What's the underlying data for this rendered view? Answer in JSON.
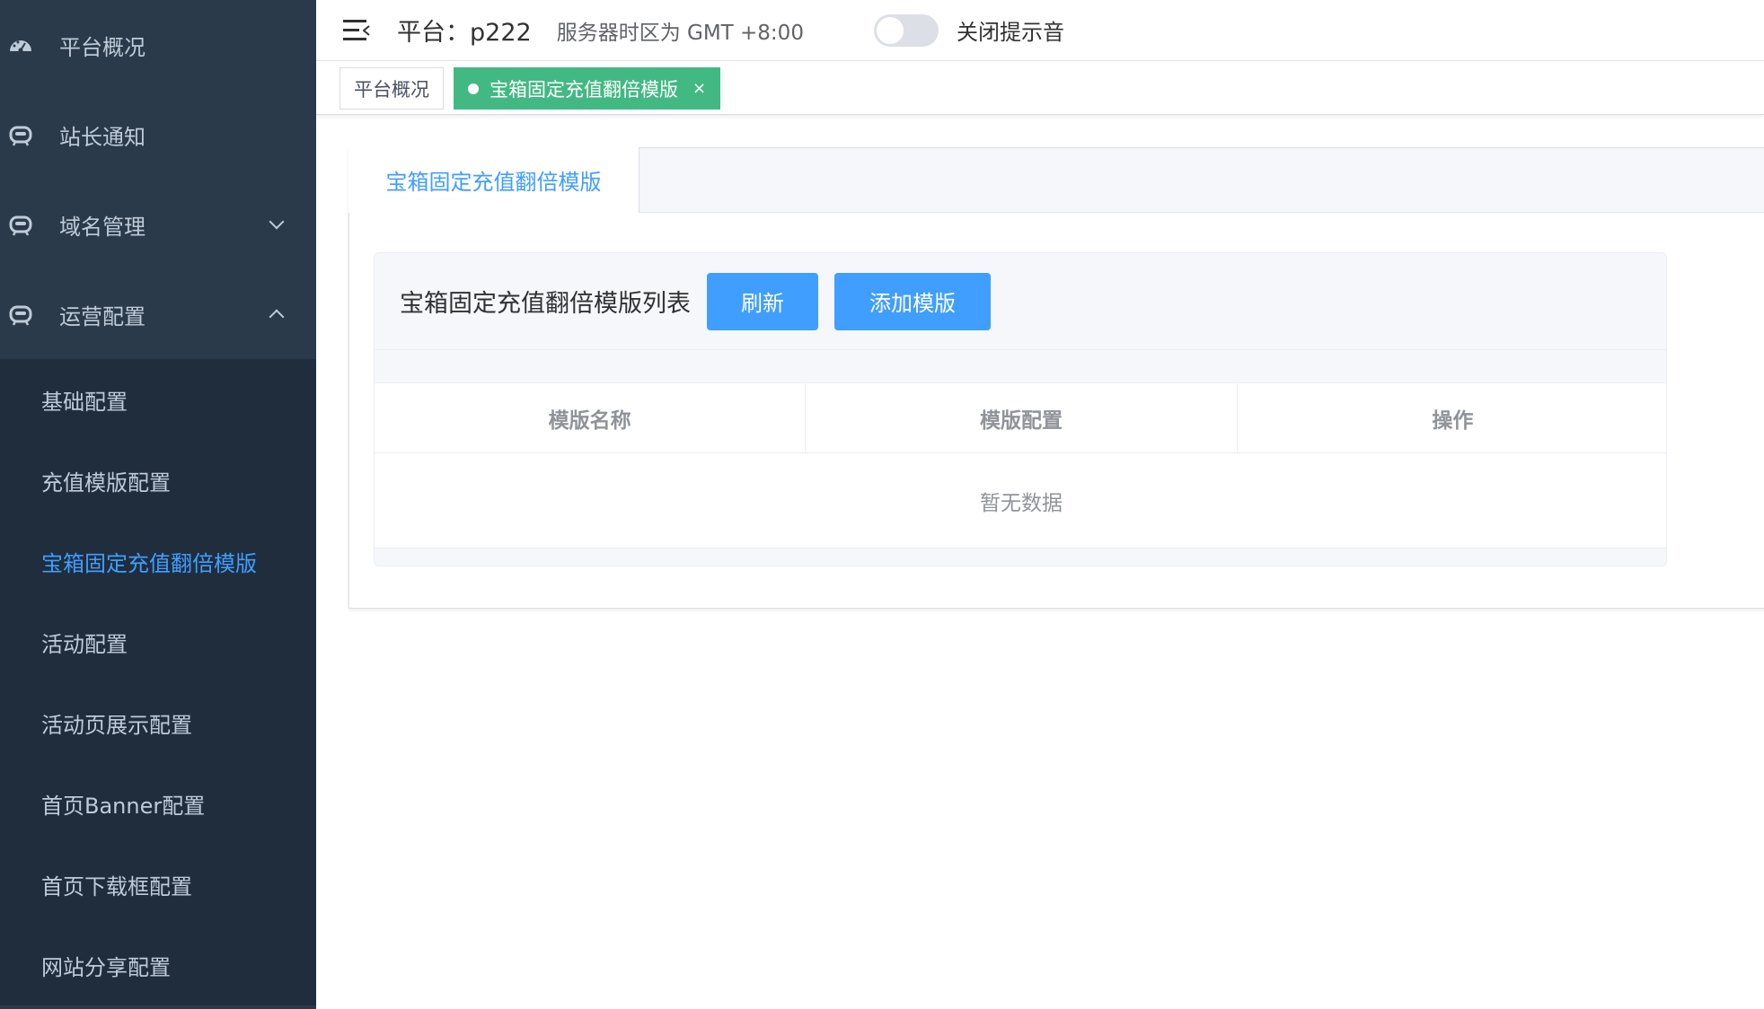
{
  "sidebar": {
    "menus": [
      {
        "label": "平台概况",
        "icon": "dashboard-icon"
      },
      {
        "label": "站长通知",
        "icon": "robot-icon"
      },
      {
        "label": "域名管理",
        "icon": "robot-icon",
        "arrow": "chevron-down-icon"
      },
      {
        "label": "运营配置",
        "icon": "robot-icon",
        "arrow": "chevron-up-icon"
      }
    ],
    "submenu": [
      {
        "label": "基础配置"
      },
      {
        "label": "充值模版配置"
      },
      {
        "label": "宝箱固定充值翻倍模版",
        "active": true
      },
      {
        "label": "活动配置"
      },
      {
        "label": "活动页展示配置"
      },
      {
        "label": "首页Banner配置"
      },
      {
        "label": "首页下载框配置"
      },
      {
        "label": "网站分享配置"
      }
    ]
  },
  "header": {
    "platform": "平台：p222",
    "timezone": "服务器时区为 GMT +8:00",
    "sound_toggle_on": false,
    "sound_label": "关闭提示音"
  },
  "tags": [
    {
      "label": "平台概况",
      "active": false
    },
    {
      "label": "宝箱固定充值翻倍模版",
      "active": true,
      "close": "×"
    }
  ],
  "main": {
    "tab": "宝箱固定充值翻倍模版",
    "panel_title": "宝箱固定充值翻倍模版列表",
    "refresh_label": "刷新",
    "add_label": "添加模版",
    "columns": [
      "模版名称",
      "模版配置",
      "操作"
    ],
    "empty_text": "暂无数据"
  },
  "colors": {
    "sidebar_bg": "#2b3a4a",
    "submenu_bg": "#1f2d3d",
    "accent": "#409eff",
    "tag_active": "#42b983"
  }
}
